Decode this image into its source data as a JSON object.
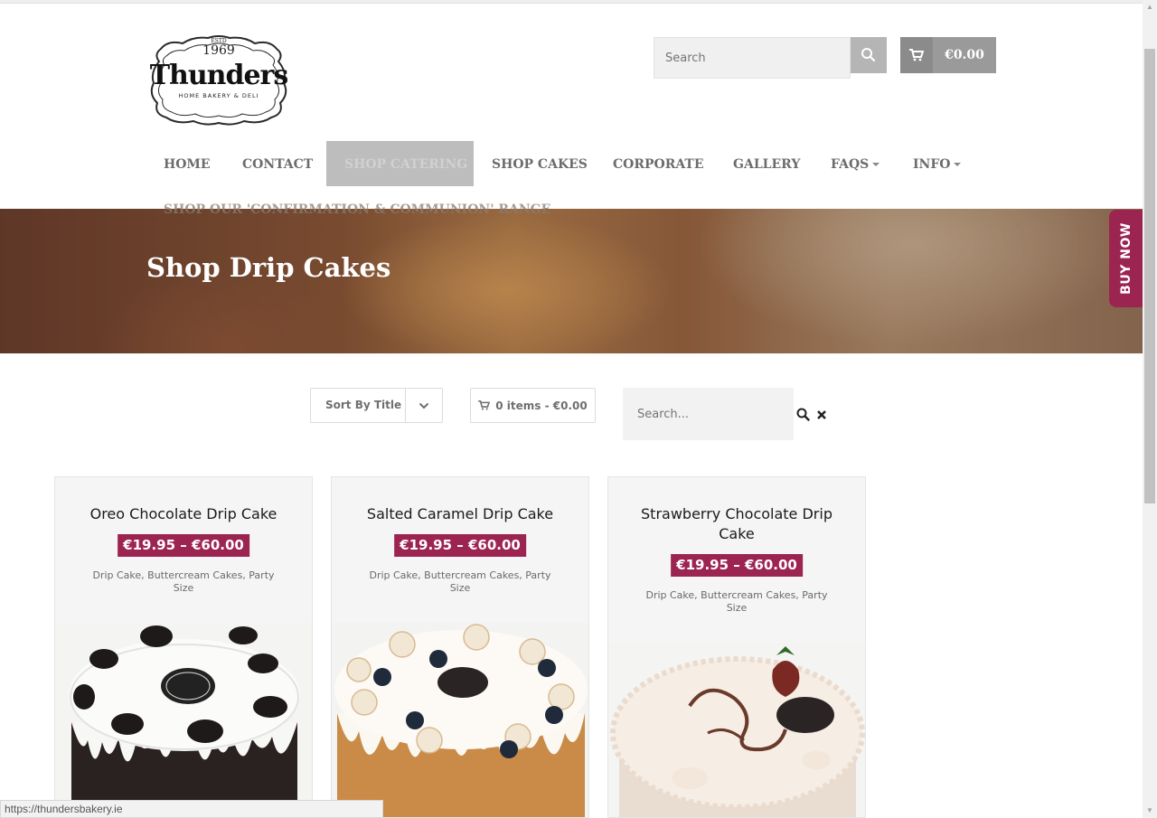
{
  "header": {
    "logo": {
      "established": "ESTD",
      "year": "1969",
      "brand": "Thunders",
      "tagline": "HOME BAKERY & DELI"
    },
    "search_placeholder": "Search",
    "cart_total": "€0.00"
  },
  "nav": {
    "items": [
      {
        "label": "HOME"
      },
      {
        "label": "CONTACT"
      },
      {
        "label": "SHOP CATERING",
        "active": true
      },
      {
        "label": "SHOP CAKES"
      },
      {
        "label": "CORPORATE"
      },
      {
        "label": "GALLERY"
      },
      {
        "label": "FAQS",
        "dropdown": true
      },
      {
        "label": "INFO",
        "dropdown": true
      }
    ],
    "second_row": "SHOP OUR 'CONFIRMATION & COMMUNION' RANGE"
  },
  "hero": {
    "title": "Shop Drip Cakes"
  },
  "buy_now": "BUY NOW",
  "toolbar": {
    "sort_label": "Sort By Title",
    "mini_cart": "0 items - €0.00",
    "search_placeholder": "Search..."
  },
  "products": [
    {
      "title": "Oreo Chocolate Drip Cake",
      "price": "€19.95 – €60.00",
      "categories": "Drip Cake, Buttercream Cakes, Party Size"
    },
    {
      "title": "Salted Caramel Drip Cake",
      "price": "€19.95 – €60.00",
      "categories": "Drip Cake, Buttercream Cakes, Party Size"
    },
    {
      "title": "Strawberry Chocolate Drip Cake",
      "price": "€19.95 – €60.00",
      "categories": "Drip Cake, Buttercream Cakes, Party Size"
    }
  ],
  "status_bar": {
    "url": "https://thundersbakery.ie"
  },
  "colors": {
    "accent": "#9c2451",
    "nav_text": "#6c6c6c",
    "cart_button": "#9a9a9a"
  },
  "icons": [
    "search-icon",
    "cart-icon",
    "chevron-down-icon",
    "close-icon"
  ]
}
